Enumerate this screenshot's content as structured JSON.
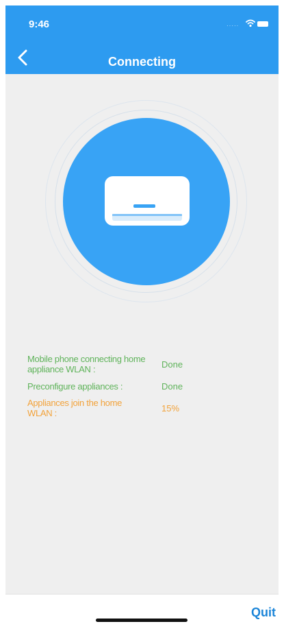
{
  "status_bar": {
    "time": "9:46",
    "signal_icon": "signal-dots-icon",
    "wifi_icon": "wifi-icon",
    "battery_icon": "battery-icon"
  },
  "nav": {
    "back_icon": "chevron-left-icon",
    "title": "Connecting"
  },
  "hero": {
    "icon": "air-conditioner-icon"
  },
  "progress": {
    "steps": [
      {
        "label": "Mobile phone connecting home appliance WLAN :",
        "value": "Done",
        "status": "done"
      },
      {
        "label": "Preconfigure appliances :",
        "value": "Done",
        "status": "done"
      },
      {
        "label": "Appliances join the home WLAN :",
        "value": "15%",
        "status": "in-progress"
      }
    ]
  },
  "footer": {
    "quit_label": "Quit"
  },
  "colors": {
    "header_blue": "#2d9bf0",
    "circle_blue": "#38a3f5",
    "done_green": "#5fb35a",
    "pending_orange": "#f2a23a",
    "quit_blue": "#1a84d8",
    "background": "#efefef"
  }
}
